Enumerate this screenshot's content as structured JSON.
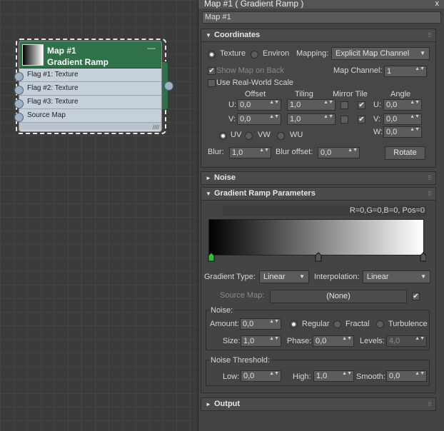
{
  "node": {
    "title1": "Map #1",
    "title2": "Gradient Ramp",
    "minimize": "—",
    "grip": "////",
    "inputs": [
      "Flag #1: Texture",
      "Flag #2: Texture",
      "Flag #3: Texture",
      "Source Map"
    ]
  },
  "panel": {
    "title": "Map #1  ( Gradient Ramp )",
    "close": "x",
    "name": "Map #1"
  },
  "rollouts": {
    "coordinates": "Coordinates",
    "noise": "Noise",
    "gradient_ramp": "Gradient Ramp Parameters",
    "output": "Output",
    "grip": "⠿"
  },
  "coords": {
    "texture": "Texture",
    "environ": "Environ",
    "mapping_label": "Mapping:",
    "mapping_value": "Explicit Map Channel",
    "show_map": "Show Map on Back",
    "map_channel_label": "Map Channel:",
    "map_channel_value": "1",
    "real_world": "Use Real-World Scale",
    "col_offset": "Offset",
    "col_tiling": "Tiling",
    "col_mirror_tile": "Mirror Tile",
    "col_angle": "Angle",
    "u": "U:",
    "v": "V:",
    "w": "W:",
    "u_offset": "0,0",
    "v_offset": "0,0",
    "u_tiling": "1,0",
    "v_tiling": "1,0",
    "u_angle": "0,0",
    "v_angle": "0,0",
    "w_angle": "0,0",
    "uv": "UV",
    "vw": "VW",
    "wu": "WU",
    "blur_label": "Blur:",
    "blur_value": "1,0",
    "blur_offset_label": "Blur offset:",
    "blur_offset_value": "0,0",
    "rotate": "Rotate",
    "check": "✔"
  },
  "gradient": {
    "readout": "R=0,G=0,B=0, Pos=0",
    "type_label": "Gradient Type:",
    "type_value": "Linear",
    "interp_label": "Interpolation:",
    "interp_value": "Linear",
    "source_map_label": "Source Map:",
    "source_map_value": "(None)",
    "noise_group": "Noise:",
    "amount_label": "Amount:",
    "amount_value": "0,0",
    "regular": "Regular",
    "fractal": "Fractal",
    "turbulence": "Turbulence",
    "size_label": "Size:",
    "size_value": "1,0",
    "phase_label": "Phase:",
    "phase_value": "0,0",
    "levels_label": "Levels:",
    "levels_value": "4,0",
    "threshold_group": "Noise Threshold:",
    "low_label": "Low:",
    "low_value": "0,0",
    "high_label": "High:",
    "high_value": "1,0",
    "smooth_label": "Smooth:",
    "smooth_value": "0,0"
  },
  "icons": {
    "expanded": "▼",
    "collapsed": "►",
    "spinner": "▲▼",
    "dropdown": "▼"
  },
  "colors": {
    "node_header": "#2f7148",
    "flag_active": "#2fbf3a",
    "flag_inactive": "#555555"
  }
}
